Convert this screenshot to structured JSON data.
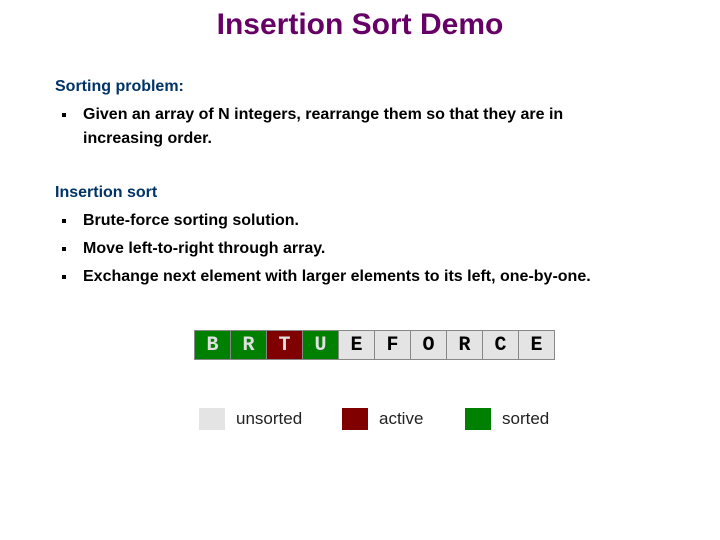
{
  "title": "Insertion Sort Demo",
  "sections": [
    {
      "heading": "Sorting problem:",
      "bullets": [
        "Given an array of N integers, rearrange them so that they are in",
        "increasing order."
      ]
    },
    {
      "heading": "Insertion sort",
      "bullets": [
        "Brute-force sorting solution.",
        "Move left-to-right through array.",
        "Exchange next element with larger elements to its left, one-by-one."
      ]
    }
  ],
  "array": [
    {
      "letter": "B",
      "state": "sorted"
    },
    {
      "letter": "R",
      "state": "sorted"
    },
    {
      "letter": "T",
      "state": "active"
    },
    {
      "letter": "U",
      "state": "sorted"
    },
    {
      "letter": "E",
      "state": "unsorted"
    },
    {
      "letter": "F",
      "state": "unsorted"
    },
    {
      "letter": "O",
      "state": "unsorted"
    },
    {
      "letter": "R",
      "state": "unsorted"
    },
    {
      "letter": "C",
      "state": "unsorted"
    },
    {
      "letter": "E",
      "state": "unsorted"
    }
  ],
  "legend": [
    {
      "label": "unsorted",
      "color": "#e4e4e4"
    },
    {
      "label": "active",
      "color": "#800000"
    },
    {
      "label": "sorted",
      "color": "#008000"
    }
  ]
}
